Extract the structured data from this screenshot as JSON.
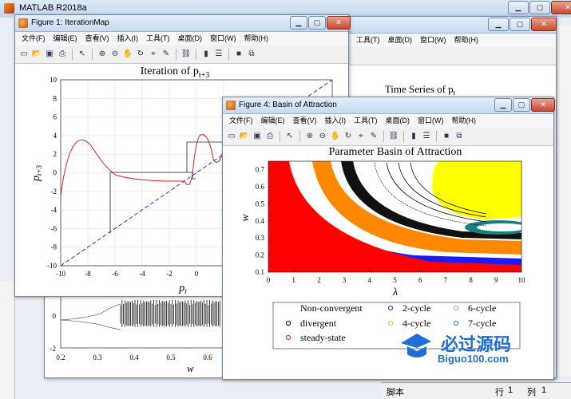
{
  "main_window": {
    "title": "MATLAB R2018a",
    "status_left": "脚本",
    "status_row_label": "行",
    "status_row": "1",
    "status_col_label": "列",
    "status_col": "1"
  },
  "menu": [
    "文件(F)",
    "编辑(E)",
    "查看(V)",
    "插入(I)",
    "工具(T)",
    "桌面(D)",
    "窗口(W)",
    "帮助(H)"
  ],
  "fig1": {
    "window_title": "Figure 1: IterationMap",
    "plot_title": "Iteration of p",
    "title_sub": "t+3",
    "xlabel": "p",
    "xlabel_sub": "t",
    "ylabel": "p",
    "ylabel_sub": "t+3",
    "xticks": [
      "-10",
      "-8",
      "-6",
      "-4",
      "-2",
      "0",
      "2"
    ],
    "yticks": [
      "10",
      "8",
      "6",
      "4",
      "2",
      "0",
      "-2",
      "-4",
      "-6",
      "-8",
      "-10"
    ]
  },
  "fig_ts": {
    "plot_title": "Time Series of p",
    "title_sub": "t",
    "xticks": [
      "0.2",
      "0.3",
      "0.4",
      "0.5",
      "0.6"
    ],
    "yticks": [
      "0",
      "-2"
    ],
    "xlabel": "w"
  },
  "fig4": {
    "window_title": "Figure 4: Basin of Attraction",
    "plot_title": "Parameter Basin of Attraction",
    "xlabel": "λ",
    "ylabel": "w",
    "xticks": [
      "0",
      "1",
      "2",
      "3",
      "4",
      "5",
      "6",
      "7",
      "8",
      "9",
      "10"
    ],
    "yticks": [
      "0.7",
      "0.6",
      "0.5",
      "0.4",
      "0.3",
      "0.2",
      "0.1"
    ],
    "legend": [
      {
        "label": "Non-convergent",
        "color": "#ffffff",
        "marker": "none"
      },
      {
        "label": "divergent",
        "color": "#000000",
        "marker": "circle"
      },
      {
        "label": "steady-state",
        "color": "#e02020",
        "marker": "circle"
      },
      {
        "label": "2-cycle",
        "color": "#2030e0",
        "marker": "circle"
      },
      {
        "label": "4-cycle",
        "color": "#e0d020",
        "marker": "circle"
      },
      {
        "label": "6-cycle",
        "color": "#a0a0a0",
        "marker": "circle"
      },
      {
        "label": "7-cycle",
        "color": "#208080",
        "marker": "circle"
      }
    ]
  },
  "watermark": {
    "text": "必过源码",
    "url_text": "Biguo100.com"
  }
}
